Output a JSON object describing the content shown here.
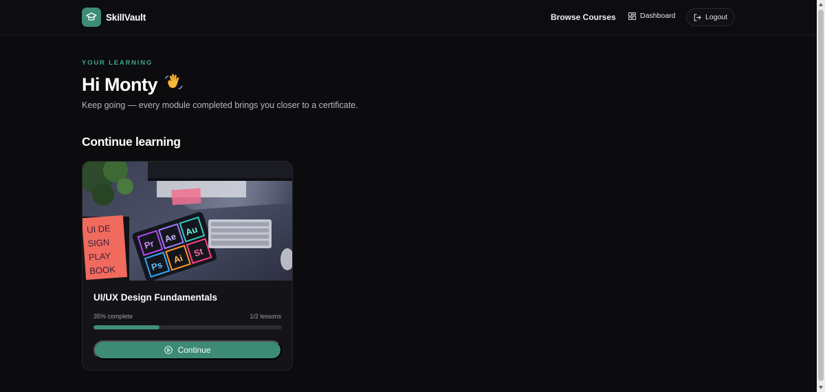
{
  "header": {
    "brand_name": "SkillVault",
    "nav_browse": "Browse Courses",
    "nav_dashboard": "Dashboard",
    "logout_label": "Logout"
  },
  "intro": {
    "eyebrow": "YOUR LEARNING",
    "greeting": "Hi Monty",
    "wave_emoji": "👋",
    "subtitle": "Keep going — every module completed brings you closer to a certificate."
  },
  "continue_section": {
    "title": "Continue learning",
    "courses": [
      {
        "title": "UI/UX Design Fundamentals",
        "progress_text": "35% complete",
        "progress_value": 0.35,
        "lessons_text": "1/2 lessons",
        "button_label": "Continue",
        "image_icon": "design-desk-photo",
        "image_tiles": [
          "Pr",
          "Ae",
          "Au",
          "Ps",
          "Ai",
          "St"
        ]
      }
    ]
  },
  "colors": {
    "accent": "#3d8a75",
    "accent_text": "#45a68a",
    "background": "#0c0b0e",
    "card": "#141317"
  }
}
